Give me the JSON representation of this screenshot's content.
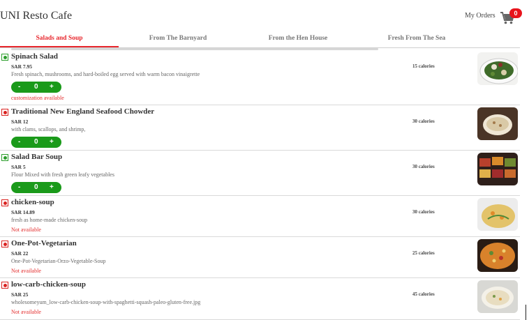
{
  "header": {
    "title": "UNI Resto Cafe",
    "my_orders": "My Orders",
    "cart_count": "0"
  },
  "tabs": [
    {
      "label": "Salads and Soup",
      "active": true
    },
    {
      "label": "From The Barnyard",
      "active": false
    },
    {
      "label": "From the Hen House",
      "active": false
    },
    {
      "label": "Fresh From The Sea",
      "active": false
    }
  ],
  "items": [
    {
      "name": "Spinach Salad",
      "price": "SAR 7.95",
      "description": "Fresh spinach, mushrooms, and hard-boiled egg served with warm bacon vinaigrette",
      "calories": "15 calories",
      "veg": true,
      "quantity": "0",
      "note": "customization available",
      "stepper": {
        "minus": "-",
        "plus": "+"
      }
    },
    {
      "name": "Traditional New England Seafood Chowder",
      "price": "SAR 12",
      "description": "with clams, scallops, and shrimp,",
      "calories": "30 calories",
      "veg": false,
      "quantity": "0",
      "note": "",
      "stepper": {
        "minus": "-",
        "plus": "+"
      }
    },
    {
      "name": "Salad Bar Soup",
      "price": "SAR 5",
      "description": "Flour Mixed with fresh green leafy vegetables",
      "calories": "30 calories",
      "veg": true,
      "quantity": "0",
      "note": "",
      "stepper": {
        "minus": "-",
        "plus": "+"
      }
    },
    {
      "name": "chicken-soup",
      "price": "SAR 14.89",
      "description": "fresh as home-made chicken-soup",
      "calories": "30 calories",
      "veg": false,
      "note": "Not available"
    },
    {
      "name": "One-Pot-Vegetarian",
      "price": "SAR 22",
      "description": "One-Pot-Vegetarian-Orzo-Vegetable-Soup",
      "calories": "25 calories",
      "veg": false,
      "note": "Not available"
    },
    {
      "name": "low-carb-chicken-soup",
      "price": "SAR 25",
      "description": "wholesomeyum_low-carb-chicken-soup-with-spaghetti-squash-paleo-gluten-free.jpg",
      "calories": "45 calories",
      "veg": false,
      "note": "Not available"
    }
  ],
  "colors": {
    "accent": "#e8272d",
    "stepper": "#1a9a1a",
    "veg": "#2a9d2a",
    "nonveg": "#d9211f"
  }
}
